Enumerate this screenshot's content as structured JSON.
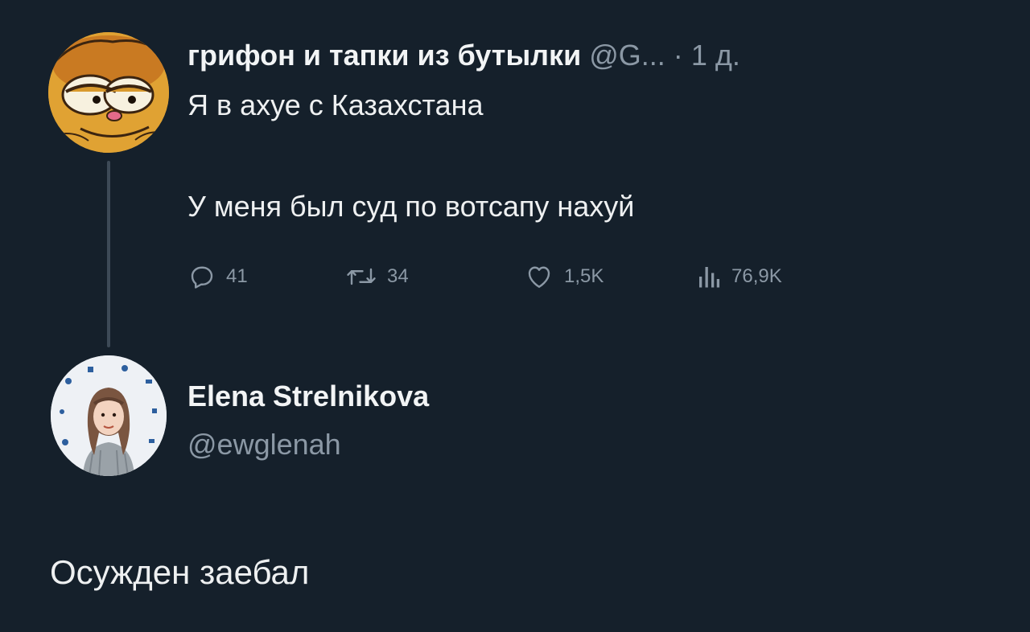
{
  "tweet": {
    "author_name": "грифон и тапки из бутылки",
    "handle": "@G...",
    "separator": "·",
    "time": "1 д.",
    "text_line1": "Я в ахуе с Казахстана",
    "text_line2": "У меня был суд по вотсапу нахуй",
    "stats": {
      "replies": "41",
      "retweets": "34",
      "likes": "1,5K",
      "views": "76,9K"
    }
  },
  "reply": {
    "author_name": "Elena Strelnikova",
    "handle": "@ewglenah",
    "text": "Осужден заебал"
  },
  "icons": {
    "reply": "speech-bubble-icon",
    "retweet": "retweet-icon",
    "like": "heart-icon",
    "views": "bar-chart-icon"
  },
  "colors": {
    "background": "#15202b",
    "text_primary": "#eef0f1",
    "text_secondary": "#8b98a5",
    "thread_line": "#3d4a57"
  }
}
